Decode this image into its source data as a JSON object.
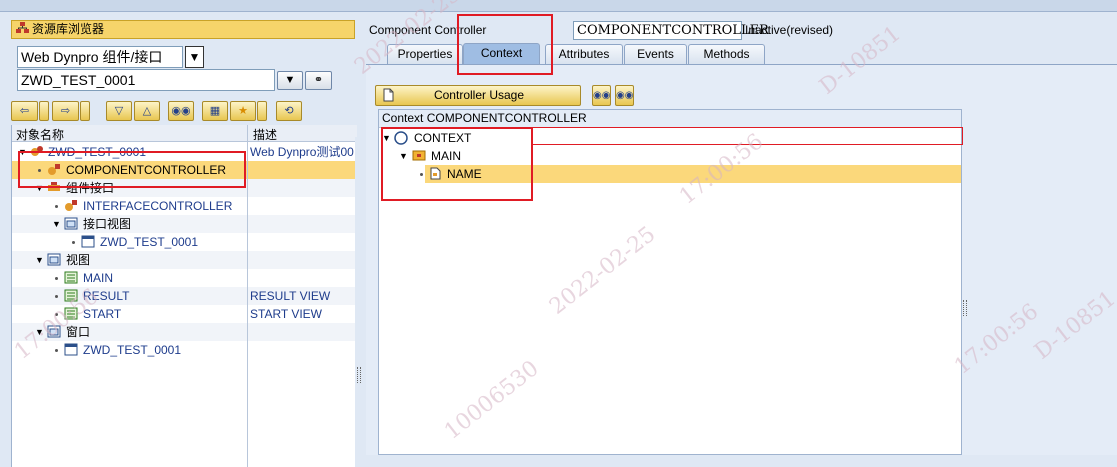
{
  "left": {
    "repo_title": "资源库浏览器",
    "object_type": "Web Dynpro 组件/接口",
    "object_name": "ZWD_TEST_0001",
    "tree_header": {
      "col_name": "对象名称",
      "col_desc": "描述"
    },
    "tree": [
      {
        "label": "ZWD_TEST_0001",
        "desc": "Web Dynpro测试00",
        "icon": "component-icon"
      },
      {
        "label": "COMPONENTCONTROLLER",
        "desc": "",
        "icon": "controller-icon"
      },
      {
        "label": "组件接口",
        "desc": "",
        "icon": "component-interface-icon"
      },
      {
        "label": "INTERFACECONTROLLER",
        "desc": "",
        "icon": "controller-icon"
      },
      {
        "label": "接口视图",
        "desc": "",
        "icon": "folder-icon"
      },
      {
        "label": "ZWD_TEST_0001",
        "desc": "",
        "icon": "window-icon"
      },
      {
        "label": "视图",
        "desc": "",
        "icon": "folder-icon"
      },
      {
        "label": "MAIN",
        "desc": "",
        "icon": "view-icon"
      },
      {
        "label": "RESULT",
        "desc": "RESULT VIEW",
        "icon": "view-icon"
      },
      {
        "label": "START",
        "desc": "START VIEW",
        "icon": "view-icon"
      },
      {
        "label": "窗口",
        "desc": "",
        "icon": "folder-icon"
      },
      {
        "label": "ZWD_TEST_0001",
        "desc": "",
        "icon": "window-icon"
      }
    ]
  },
  "right": {
    "controller_label": "Component Controller",
    "controller_name": "COMPONENTCONTROLLER",
    "status": "Inactive(revised)",
    "tabs": [
      "Properties",
      "Context",
      "Attributes",
      "Events",
      "Methods"
    ],
    "active_tab": "Context",
    "usage_button": "Controller Usage",
    "context_header": "Context COMPONENTCONTROLLER",
    "context_tree": [
      {
        "label": "CONTEXT",
        "icon": "context-root-icon"
      },
      {
        "label": "MAIN",
        "icon": "node-icon"
      },
      {
        "label": "NAME",
        "icon": "attribute-icon"
      }
    ]
  },
  "watermark": {
    "date": "2022-02-25",
    "time": "17:00:56",
    "user_id": "10006530",
    "code": "D-10851"
  },
  "colors": {
    "selection": "#fbd87b",
    "header_yellow": "#f6d46a",
    "annotation_red": "#e01b24",
    "link_blue": "#1e3c8c"
  }
}
